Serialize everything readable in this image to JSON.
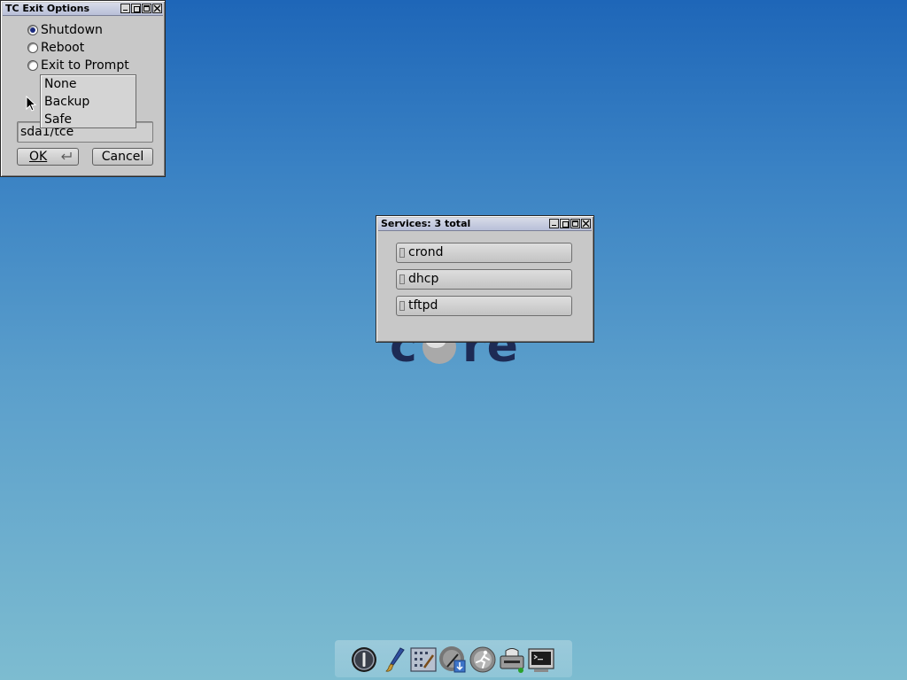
{
  "exit_window": {
    "title": "TC Exit Options",
    "options": [
      {
        "label": "Shutdown",
        "checked": true
      },
      {
        "label": "Reboot",
        "checked": false
      },
      {
        "label": "Exit to Prompt",
        "checked": false
      }
    ],
    "backup_path": "sda1/tce",
    "ok_label": "OK",
    "cancel_label": "Cancel"
  },
  "backup_menu": {
    "items": [
      "None",
      "Backup",
      "Safe"
    ]
  },
  "services_window": {
    "title": "Services: 3 total",
    "services": [
      "crond",
      "dhcp",
      "tftpd"
    ]
  },
  "dock": {
    "icons": [
      "exit-power-icon",
      "paintbrush-icon",
      "control-panel-icon",
      "apps-icon",
      "run-icon",
      "mount-tool-icon",
      "terminal-icon"
    ]
  },
  "colors": {
    "desktop_top": "#1e66b8",
    "desktop_bottom": "#7dbcd0",
    "window_bg": "#c8c8c8",
    "titlebar": "#b8bfd8"
  }
}
